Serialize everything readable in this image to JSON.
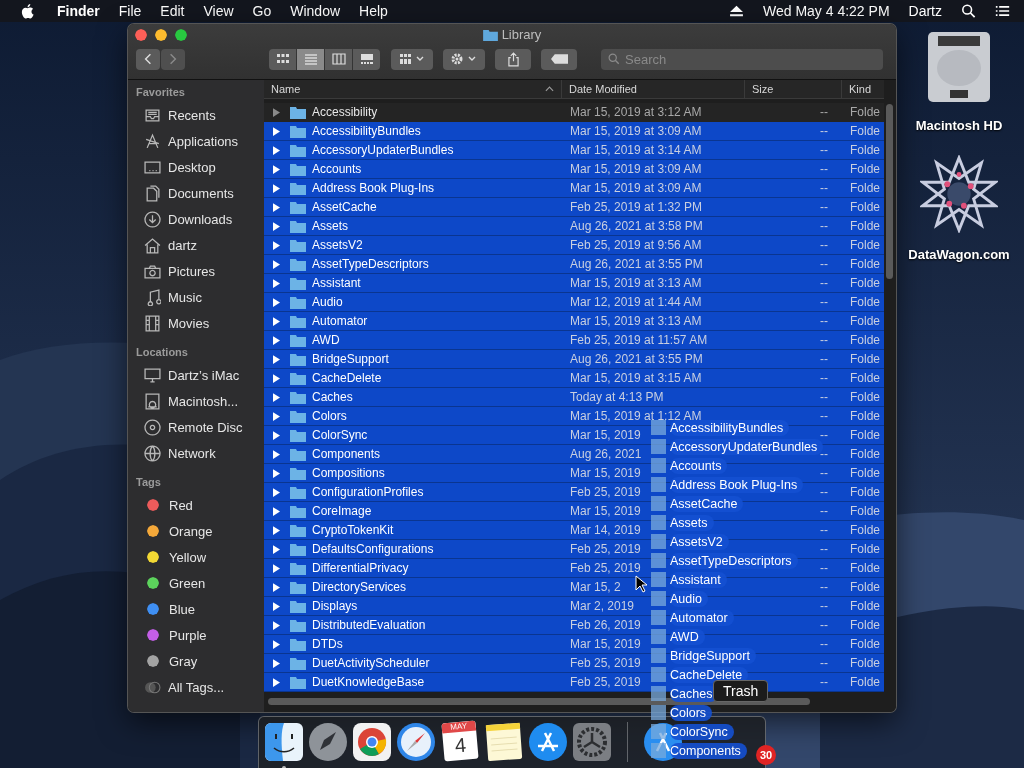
{
  "menu_bar": {
    "menus": [
      "Finder",
      "File",
      "Edit",
      "View",
      "Go",
      "Window",
      "Help"
    ],
    "clock": "Wed May 4  4:22 PM",
    "user": "Dartz"
  },
  "window": {
    "title": "Library",
    "nav": [
      {
        "disabled": false
      },
      {
        "disabled": true
      }
    ],
    "view_modes": [
      {
        "selected": false
      },
      {
        "selected": true
      },
      {
        "selected": false
      },
      {
        "selected": false
      }
    ],
    "search": {
      "placeholder": "Search"
    }
  },
  "sidebar": {
    "sections": [
      {
        "title": "Favorites",
        "items": [
          {
            "label": "Recents"
          },
          {
            "label": "Applications"
          },
          {
            "label": "Desktop"
          },
          {
            "label": "Documents"
          },
          {
            "label": "Downloads"
          },
          {
            "label": "dartz"
          },
          {
            "label": "Pictures"
          },
          {
            "label": "Music"
          },
          {
            "label": "Movies"
          }
        ]
      },
      {
        "title": "Locations",
        "items": [
          {
            "label": "Dartz’s iMac"
          },
          {
            "label": "Macintosh..."
          },
          {
            "label": "Remote Disc"
          },
          {
            "label": "Network"
          }
        ]
      },
      {
        "title": "Tags",
        "items": [
          {
            "label": "Red",
            "color": "#ec5b5b"
          },
          {
            "label": "Orange",
            "color": "#f4a83a"
          },
          {
            "label": "Yellow",
            "color": "#f3d934"
          },
          {
            "label": "Green",
            "color": "#5cd35c"
          },
          {
            "label": "Blue",
            "color": "#3f8ff3"
          },
          {
            "label": "Purple",
            "color": "#c35ee6"
          },
          {
            "label": "Gray",
            "color": "#a3a3a3"
          },
          {
            "label": "All Tags..."
          }
        ]
      }
    ]
  },
  "table": {
    "columns": [
      {
        "label": "Name",
        "sorted": true
      },
      {
        "label": "Date Modified",
        "sorted": false
      },
      {
        "label": "Size",
        "sorted": false
      },
      {
        "label": "Kind",
        "sorted": false
      }
    ],
    "rows": [
      {
        "name": "Accessibility",
        "date": "Mar 15, 2019 at 3:12 AM",
        "size": "--",
        "kind": "Folde",
        "selected": false
      },
      {
        "name": "AccessibilityBundles",
        "date": "Mar 15, 2019 at 3:09 AM",
        "size": "--",
        "kind": "Folde",
        "selected": true
      },
      {
        "name": "AccessoryUpdaterBundles",
        "date": "Mar 15, 2019 at 3:14 AM",
        "size": "--",
        "kind": "Folde",
        "selected": true
      },
      {
        "name": "Accounts",
        "date": "Mar 15, 2019 at 3:09 AM",
        "size": "--",
        "kind": "Folde",
        "selected": true
      },
      {
        "name": "Address Book Plug-Ins",
        "date": "Mar 15, 2019 at 3:09 AM",
        "size": "--",
        "kind": "Folde",
        "selected": true
      },
      {
        "name": "AssetCache",
        "date": "Feb 25, 2019 at 1:32 PM",
        "size": "--",
        "kind": "Folde",
        "selected": true
      },
      {
        "name": "Assets",
        "date": "Aug 26, 2021 at 3:58 PM",
        "size": "--",
        "kind": "Folde",
        "selected": true
      },
      {
        "name": "AssetsV2",
        "date": "Feb 25, 2019 at 9:56 AM",
        "size": "--",
        "kind": "Folde",
        "selected": true
      },
      {
        "name": "AssetTypeDescriptors",
        "date": "Aug 26, 2021 at 3:55 PM",
        "size": "--",
        "kind": "Folde",
        "selected": true
      },
      {
        "name": "Assistant",
        "date": "Mar 15, 2019 at 3:13 AM",
        "size": "--",
        "kind": "Folde",
        "selected": true
      },
      {
        "name": "Audio",
        "date": "Mar 12, 2019 at 1:44 AM",
        "size": "--",
        "kind": "Folde",
        "selected": true
      },
      {
        "name": "Automator",
        "date": "Mar 15, 2019 at 3:13 AM",
        "size": "--",
        "kind": "Folde",
        "selected": true
      },
      {
        "name": "AWD",
        "date": "Feb 25, 2019 at 11:57 AM",
        "size": "--",
        "kind": "Folde",
        "selected": true
      },
      {
        "name": "BridgeSupport",
        "date": "Aug 26, 2021 at 3:55 PM",
        "size": "--",
        "kind": "Folde",
        "selected": true
      },
      {
        "name": "CacheDelete",
        "date": "Mar 15, 2019 at 3:15 AM",
        "size": "--",
        "kind": "Folde",
        "selected": true
      },
      {
        "name": "Caches",
        "date": "Today at 4:13 PM",
        "size": "--",
        "kind": "Folde",
        "selected": true
      },
      {
        "name": "Colors",
        "date": "Mar 15, 2019 at 1:12 AM",
        "size": "--",
        "kind": "Folde",
        "selected": true
      },
      {
        "name": "ColorSync",
        "date": "Mar 15, 2019",
        "size": "--",
        "kind": "Folde",
        "selected": true
      },
      {
        "name": "Components",
        "date": "Aug 26, 2021",
        "size": "--",
        "kind": "Folde",
        "selected": true
      },
      {
        "name": "Compositions",
        "date": "Mar 15, 2019",
        "size": "--",
        "kind": "Folde",
        "selected": true
      },
      {
        "name": "ConfigurationProfiles",
        "date": "Feb 25, 2019",
        "size": "--",
        "kind": "Folde",
        "selected": true
      },
      {
        "name": "CoreImage",
        "date": "Mar 15, 2019",
        "size": "--",
        "kind": "Folde",
        "selected": true
      },
      {
        "name": "CryptoTokenKit",
        "date": "Mar 14, 2019",
        "size": "--",
        "kind": "Folde",
        "selected": true
      },
      {
        "name": "DefaultsConfigurations",
        "date": "Feb 25, 2019",
        "size": "--",
        "kind": "Folde",
        "selected": true
      },
      {
        "name": "DifferentialPrivacy",
        "date": "Feb 25, 2019",
        "size": "--",
        "kind": "Folde",
        "selected": true
      },
      {
        "name": "DirectoryServices",
        "date": "Mar 15, 2",
        "size": "--",
        "kind": "Folde",
        "selected": true
      },
      {
        "name": "Displays",
        "date": "Mar 2, 2019",
        "size": "--",
        "kind": "Folde",
        "selected": true
      },
      {
        "name": "DistributedEvaluation",
        "date": "Feb 26, 2019",
        "size": "--",
        "kind": "Folde",
        "selected": true
      },
      {
        "name": "DTDs",
        "date": "Mar 15, 2019",
        "size": "--",
        "kind": "Folde",
        "selected": true
      },
      {
        "name": "DuetActivityScheduler",
        "date": "Feb 25, 2019",
        "size": "--",
        "kind": "Folde",
        "selected": true
      },
      {
        "name": "DuetKnowledgeBase",
        "date": "Feb 25, 2019",
        "size": "--",
        "kind": "Folde",
        "selected": true
      }
    ]
  },
  "drag_preview": {
    "items": [
      "AccessibilityBundles",
      "AccessoryUpdaterBundles",
      "Accounts",
      "Address Book Plug-Ins",
      "AssetCache",
      "Assets",
      "AssetsV2",
      "AssetTypeDescriptors",
      "Assistant",
      "Audio",
      "Automator",
      "AWD",
      "BridgeSupport",
      "CacheDelete",
      "Caches",
      "Colors",
      "ColorSync",
      "Components"
    ]
  },
  "dock": {
    "calendar": {
      "month": "MAY",
      "day": "4"
    },
    "tooltip": "Trash",
    "badge": "30"
  },
  "desktop": {
    "icons": [
      {
        "label": "Macintosh HD"
      },
      {
        "label": "DataWagon.com"
      }
    ]
  }
}
